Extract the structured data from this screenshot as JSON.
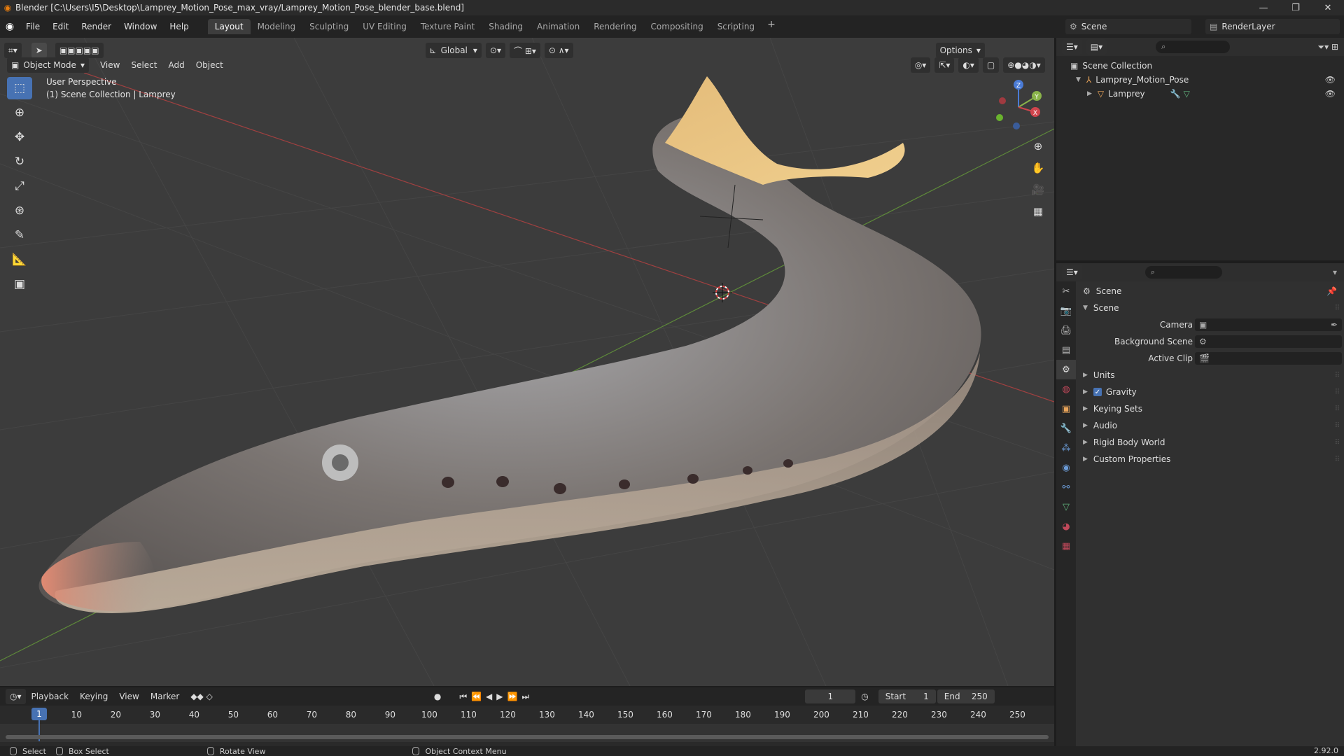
{
  "window": {
    "title": "Blender [C:\\Users\\I5\\Desktop\\Lamprey_Motion_Pose_max_vray/Lamprey_Motion_Pose_blender_base.blend]",
    "min": "—",
    "max": "❐",
    "close": "✕"
  },
  "menu": [
    "File",
    "Edit",
    "Render",
    "Window",
    "Help"
  ],
  "workspaces": [
    "Layout",
    "Modeling",
    "Sculpting",
    "UV Editing",
    "Texture Paint",
    "Shading",
    "Animation",
    "Rendering",
    "Compositing",
    "Scripting"
  ],
  "workspace_add": "+",
  "scene_name": "Scene",
  "render_layer": "RenderLayer",
  "viewport": {
    "mode": "Object Mode",
    "menus": [
      "View",
      "Select",
      "Add",
      "Object"
    ],
    "transform_orientation": "Global",
    "options_label": "Options",
    "overlay_line1": "User Perspective",
    "overlay_line2": "(1) Scene Collection | Lamprey",
    "gizmo": {
      "x": "X",
      "y": "Y",
      "z": "Z"
    }
  },
  "outliner": {
    "root": "Scene Collection",
    "items": [
      {
        "name": "Lamprey_Motion_Pose"
      },
      {
        "name": "Lamprey"
      }
    ]
  },
  "properties": {
    "context": "Scene",
    "section": "Scene",
    "fields": [
      {
        "label": "Camera"
      },
      {
        "label": "Background Scene"
      },
      {
        "label": "Active Clip"
      }
    ],
    "panels": [
      "Units",
      "Gravity",
      "Keying Sets",
      "Audio",
      "Rigid Body World",
      "Custom Properties"
    ],
    "gravity_checked": "✓"
  },
  "timeline": {
    "menus": [
      "Playback",
      "Keying",
      "View",
      "Marker"
    ],
    "current_frame": "1",
    "start_label": "Start",
    "start": "1",
    "end_label": "End",
    "end": "250",
    "ticks": [
      "1",
      "10",
      "20",
      "30",
      "40",
      "50",
      "60",
      "70",
      "80",
      "90",
      "100",
      "110",
      "120",
      "130",
      "140",
      "150",
      "160",
      "170",
      "180",
      "190",
      "200",
      "210",
      "220",
      "230",
      "240",
      "250"
    ]
  },
  "statusbar": {
    "select": "Select",
    "box_select": "Box Select",
    "rotate_view": "Rotate View",
    "context_menu": "Object Context Menu",
    "version": "2.92.0"
  }
}
